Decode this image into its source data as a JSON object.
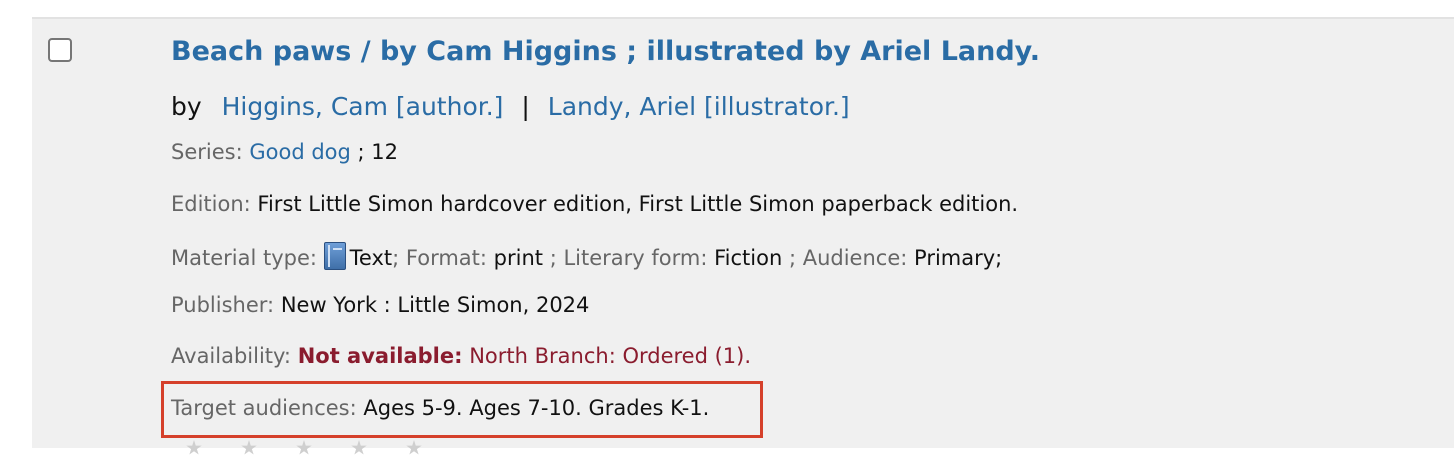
{
  "record": {
    "title": "Beach paws / by Cam Higgins ; illustrated by Ariel Landy.",
    "by_label": "by",
    "authors": [
      "Higgins, Cam [author.]",
      "Landy, Ariel [illustrator.]"
    ],
    "author_separator": "|",
    "series": {
      "label": "Series:",
      "name": "Good dog",
      "number": "; 12"
    },
    "edition": {
      "label": "Edition:",
      "value": "First Little Simon hardcover edition, First Little Simon paperback edition."
    },
    "material_type": {
      "label": "Material type:",
      "icon": "book-icon",
      "value": "Text",
      "format_label": "; Format:",
      "format_value": "print",
      "literary_form_label": "; Literary form:",
      "literary_form_value": "Fiction",
      "audience_label": "; Audience:",
      "audience_value": "Primary;"
    },
    "publisher": {
      "label": "Publisher:",
      "value": "New York : Little Simon, 2024"
    },
    "availability": {
      "label": "Availability:",
      "status": "Not available:",
      "detail": "North Branch: Ordered (1)."
    },
    "target_audiences": {
      "label": "Target audiences:",
      "value": "Ages 5-9. Ages 7-10. Grades K-1."
    }
  },
  "colors": {
    "link": "#2a6ca5",
    "label": "#666666",
    "unavailable": "#8a1c2e",
    "highlight": "#d5402b",
    "row_background": "#f0f0f0"
  }
}
